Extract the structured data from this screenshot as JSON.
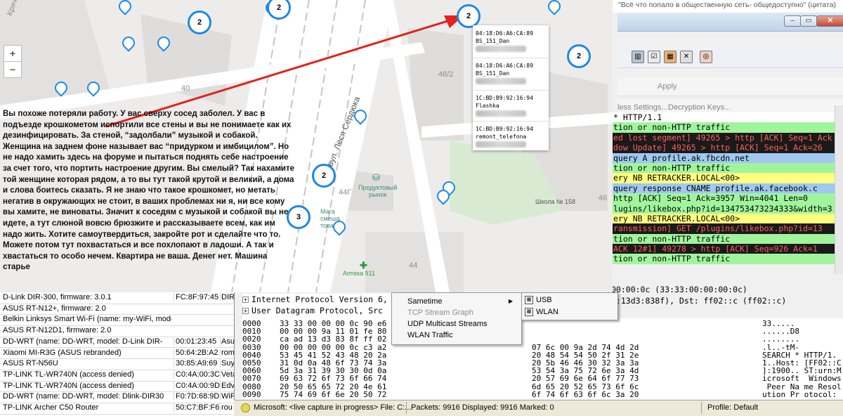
{
  "top_quote": "\"Всё что попало в общественную сеть- общедоступно\" (цитата)",
  "map": {
    "street_left": "Крячевского",
    "street_main": "вул. Леся Сердюка",
    "house_40": "40",
    "house_48_2": "48/2",
    "house_44g": "44Г",
    "house_44": "44",
    "house_46": "46",
    "market": "Продуктовый\nрынок",
    "school": "Школа № 158",
    "shop": "Мага\nсмеша\nтовар",
    "pharmacy": "Аптека 911",
    "zoom_in": "+",
    "zoom_out": "−",
    "clusters": [
      "2",
      "2",
      "2",
      "2",
      "2",
      "3"
    ]
  },
  "popup": {
    "entries": [
      {
        "mac": "04:18:D6:A6:CA:89",
        "name": "BS_151_Dan"
      },
      {
        "mac": "04:18:D6:A6:CA:89",
        "name": "BS_151_Dan"
      },
      {
        "mac": "1C:BD:B9:92:16:94",
        "name": "Flashka"
      },
      {
        "mac": "1C:BD:B9:92:16:94",
        "name": "remont_telefona"
      }
    ]
  },
  "post_text": "Вы похоже потеряли работу. У вас сверху сосед заболел. У вас в подъезде крошкометом испортили все стены и вы не понимаете как их дезинфицировать. За стеной, “задолбали” музыкой и собакой. Женщина на заднем фоне называет вас “придурком и имбицилом”. Но не надо хамить здесь на форуме и пытаться поднять себе настроение за счет того, что портить настроение другим. Вы смелый? Так нахамите той женщине которая рядом, а то вы тут такой крутой и великий, а дома и слова боитесь сказать. Я не знаю что такое крошкомет, но метать негатив в окружающих не стоит, в ваших проблемах ни я, ни все кому вы хамите, не виноваты. Значит к соседям с музыкой и собакой вы не идете, а тут слюной вовсю брюзжите и рассказываете всем, как им надо жить. Хотите самоутвердиться, закройте рот и сделайте что то. Можете потом тут похвастаться и все похлопают в ладоши. А так и хвастаться то особо нечем. Квартира не ваша. Денег нет. Машина старье",
  "router_list": [
    {
      "name": "D-Link DIR-300, firmware: 3.0.1",
      "mac": "FC:8F:97:45",
      "extra": "DIR-"
    },
    {
      "name": "ASUS RT-N12+, firmware: 2.0",
      "mac": "",
      "extra": ""
    },
    {
      "name": "Belkin Linksys Smart Wi-Fi (name: my-WiFi, model: Linksys, LLC)",
      "mac": "",
      "extra": ""
    },
    {
      "name": "ASUS RT-N12D1, firmware: 2.0",
      "mac": "",
      "extra": ""
    },
    {
      "name": "DD-WRT (name: DD-WRT, model: D-Link DIR-",
      "mac": "00:01:23:45",
      "extra": "Asu"
    },
    {
      "name": "Xiaomi MI-R3G (ASUS rebranded)",
      "mac": "50:64:2B:A2",
      "extra": "rom"
    },
    {
      "name": "ASUS RT-N56U",
      "mac": "30:85:A9:69",
      "extra": "Suy"
    },
    {
      "name": "TP-LINK TL-WR740N (access denied)",
      "mac": "C0:4A:00:3C",
      "extra": "Veta"
    },
    {
      "name": "TP-LINK TL-WR740N (access denied)",
      "mac": "C0:4A:00:9D",
      "extra": "Edv"
    },
    {
      "name": "DD-WRT (name: DD-WRT, model: Dlink-DIR30",
      "mac": "F0:7D:68:9D",
      "extra": "WiF"
    },
    {
      "name": "TP-LINK Archer C50 Router",
      "mac": "50:C7:BF:F6",
      "extra": "rou"
    }
  ],
  "wireshark": {
    "toolbar_icons": [
      "stats-icon",
      "check-icon",
      "color-icon",
      "tools-icon",
      "help-icon"
    ],
    "apply": "Apply",
    "wireless_settings": "less Settings...",
    "decryption_keys": "Decryption Keys...",
    "packets": [
      {
        "text": "* HTTP/1.1",
        "bg": "#ffffff",
        "fg": "#000000"
      },
      {
        "text": "tion or non-HTTP traffic",
        "bg": "#a0f59c",
        "fg": "#000000"
      },
      {
        "text": "ed lost segment] 49265 > http [ACK] Seq=1 Ack",
        "bg": "#1a1a1a",
        "fg": "#ff5f5f"
      },
      {
        "text": "dow Update] 49265 > http [ACK] Seq=1 Ack=26",
        "bg": "#1a1a1a",
        "fg": "#ff5f5f"
      },
      {
        "text": "query A profile.ak.fbcdn.net",
        "bg": "#a0c8f0",
        "fg": "#000000"
      },
      {
        "text": "tion or non-HTTP traffic",
        "bg": "#a0f59c",
        "fg": "#000000"
      },
      {
        "text": "ery NB RETRACKER.LOCAL<00>",
        "bg": "#ffff80",
        "fg": "#000000"
      },
      {
        "text": "query response CNAME profile.ak.facebook.c",
        "bg": "#a0c8f0",
        "fg": "#000000"
      },
      {
        "text": "http [ACK] Seq=1 Ack=3957 Win=4041 Len=0",
        "bg": "#a0f59c",
        "fg": "#000000"
      },
      {
        "text": "lugins/likebox.php?id=134753473234333&width=3",
        "bg": "#a0f59c",
        "fg": "#000000"
      },
      {
        "text": "ery NB RETRACKER.LOCAL<00>",
        "bg": "#ffff80",
        "fg": "#000000"
      },
      {
        "text": "ransmission] GET /plugins/likebox.php?id=13",
        "bg": "#1a1a1a",
        "fg": "#ff5f5f"
      },
      {
        "text": "tion or non-HTTP traffic",
        "bg": "#a0f59c",
        "fg": "#000000"
      },
      {
        "text": " ACK 12#1] 49278 > http [ACK] Seq=926 Ack=1",
        "bg": "#1a1a1a",
        "fg": "#ff5f5f"
      },
      {
        "text": "tion or non-HTTP traffic",
        "bg": "#a0f59c",
        "fg": "#000000"
      }
    ],
    "detail_right": [
      "00:00:0c (33:33:00:00:00:0c)",
      "d:13d3:838f), Dst: ff02::c (ff02::c)"
    ],
    "detail_left": [
      "Internet Protocol Version 6,",
      "User Datagram Protocol, Src"
    ],
    "hex_offsets": [
      "0000",
      "0010",
      "0020",
      "0030",
      "0040",
      "0050",
      "0060",
      "0070",
      "0080",
      "0090"
    ],
    "hex_left": [
      "33 33 00 00 00 0c 90 e6",
      "00 00 00 9a 11 01 fe 80",
      "ca ad 13 d3 83 8f ff 02",
      "00 00 00 00 00 0c c3 a2",
      "53 45 41 52 43 48 20 2a",
      "31 0d 0a 48 6f 73 74 3a",
      "5d 3a 31 39 30 30 0d 0a",
      "69 63 72 6f 73 6f 66 74",
      "20 50 65 65 72 20 4e 61",
      "75 74 69 6f 6e 20 50 72"
    ],
    "hex_right": [
      "",
      "",
      "",
      "07 6c 00 9a 2d 74 4d 2d",
      "20 48 54 54 50 2f 31 2e",
      "20 5b 46 46 30 32 3a 3a",
      "53 54 3a 75 72 6e 3a 4d",
      "20 57 69 6e 64 6f 77 73",
      "6d 65 20 52 65 73 6f 6c",
      "6f 74 6f 63 6f 6c 3a 20"
    ],
    "hex_ascii": [
      "33.....",
      "......D8",
      "........",
      ".l..-tM-",
      "SEARCH * HTTP/1.",
      "1..Host: [FF02::C",
      "]:1900.. ST:urn:M",
      "icrosoft  Windows",
      " Peer Na me Resol",
      "ution Pr otocol:"
    ],
    "status_file": "Microsoft: <live capture in progress> File: C:...",
    "status_packets": "Packets: 9916 Displayed: 9916 Marked: 0",
    "status_profile": "Profile: Default"
  },
  "context_menu": {
    "items": [
      "Sametime",
      "TCP Stream Graph",
      "UDP Multicast Streams",
      "WLAN Traffic"
    ],
    "submenu": [
      "USB",
      "WLAN"
    ]
  }
}
